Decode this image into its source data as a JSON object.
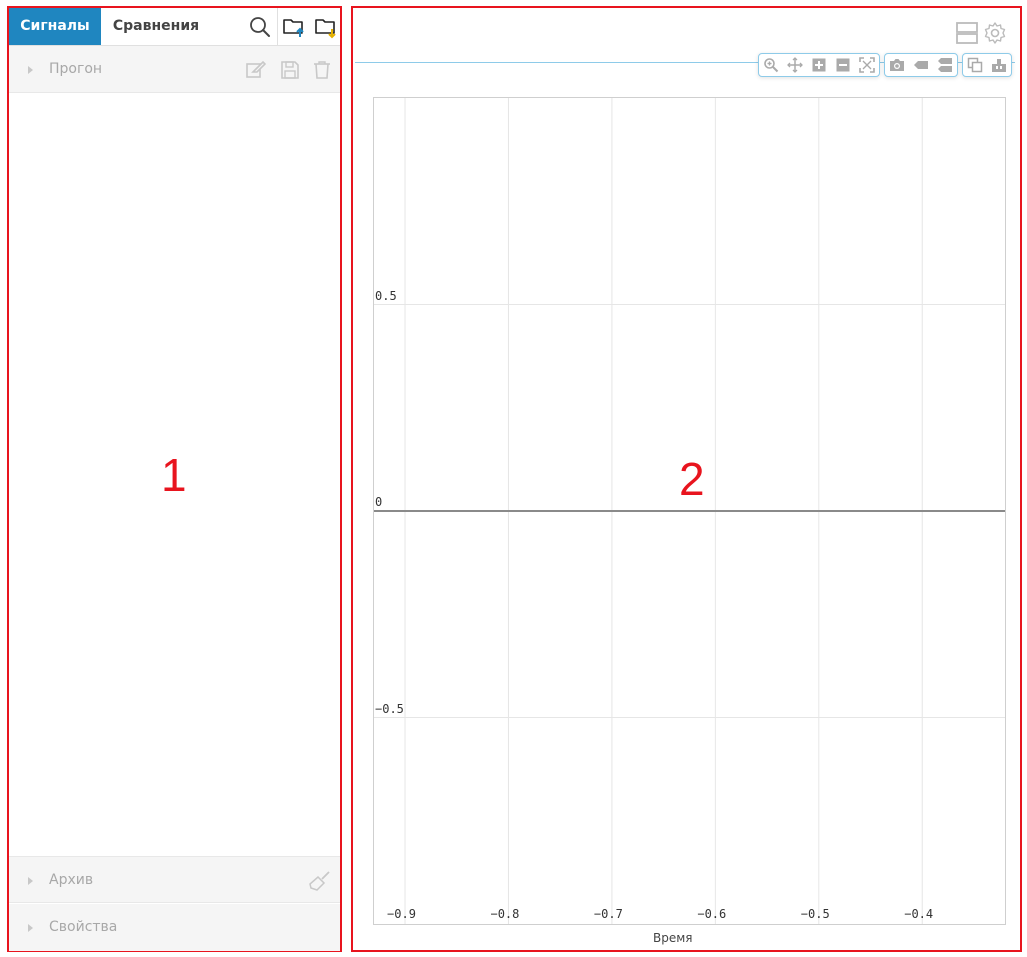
{
  "tabs": {
    "signals": "Сигналы",
    "comparisons": "Сравнения"
  },
  "toolbar": {
    "search_icon": "search-icon",
    "folder_upload_icon": "folder-upload-icon",
    "folder_download_icon": "folder-download-icon",
    "accent_blue": "#1f86c0",
    "upload_arrow_color": "#1f86c0",
    "download_arrow_color": "#e5b100"
  },
  "sections": {
    "run": "Прогон",
    "archive": "Архив",
    "properties": "Свойства"
  },
  "annotations": {
    "left_label": "1",
    "right_label": "2",
    "highlight_color": "#e8141e"
  },
  "chart_data": {
    "type": "line",
    "series": [],
    "xlabel": "Время",
    "ylabel": "",
    "title": "",
    "xlim": [
      -0.93,
      -0.32
    ],
    "ylim": [
      -1.0,
      1.0
    ],
    "x_ticks": [
      -0.9,
      -0.8,
      -0.7,
      -0.6,
      -0.5,
      -0.4
    ],
    "y_ticks": [
      0.5,
      0,
      -0.5
    ],
    "x_tick_labels": [
      "−0.9",
      "−0.8",
      "−0.7",
      "−0.6",
      "−0.5",
      "−0.4"
    ],
    "y_tick_labels": [
      "0.5",
      "0",
      "−0.5"
    ],
    "grid": true,
    "zero_line": true
  }
}
